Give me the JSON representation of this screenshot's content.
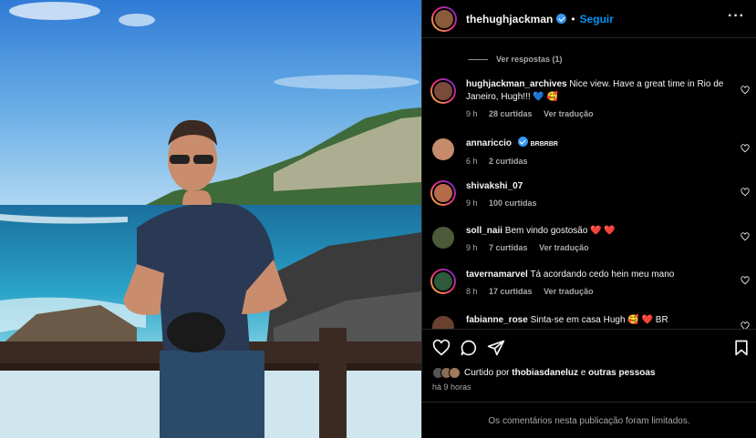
{
  "header": {
    "username": "thehughjackman",
    "separator": "•",
    "follow_label": "Seguir",
    "more_icon": "more-options-icon"
  },
  "replies": {
    "label": "Ver respostas (1)"
  },
  "comments": [
    {
      "user": "hughjackman_archives",
      "text": "Nice view. Have a great time in Rio de Janeiro, Hugh!!! 💙 🥰",
      "time": "9 h",
      "likes": "28 curtidas",
      "translate": "Ver tradução",
      "verified": false,
      "avatar_color": "#7a4a3a"
    },
    {
      "user": "annariccio",
      "text": "BRBRBR",
      "time": "6 h",
      "likes": "2 curtidas",
      "translate": "",
      "verified": true,
      "avatar_color": "#c58b6a"
    },
    {
      "user": "shivakshi_07",
      "text": "",
      "time": "9 h",
      "likes": "100 curtidas",
      "translate": "",
      "verified": false,
      "avatar_color": "#b56a4a"
    },
    {
      "user": "soll_naii",
      "text": "Bem vindo gostosão ❤️ ❤️",
      "time": "9 h",
      "likes": "7 curtidas",
      "translate": "Ver tradução",
      "verified": false,
      "avatar_color": "#4d5a3a"
    },
    {
      "user": "tavernamarvel",
      "text": "Tá acordando cedo hein meu mano",
      "time": "8 h",
      "likes": "17 curtidas",
      "translate": "Ver tradução",
      "verified": false,
      "avatar_color": "#2f5a3a"
    },
    {
      "user": "fabianne_rose",
      "text": "Sinta-se em casa Hugh 🥰 ❤️ BR",
      "time": "",
      "likes": "",
      "translate": "",
      "verified": false,
      "avatar_color": "#6a4030"
    }
  ],
  "actions": {
    "like_icon": "heart-icon",
    "comment_icon": "comment-icon",
    "share_icon": "send-icon",
    "save_icon": "bookmark-icon"
  },
  "likes": {
    "prefix": "Curtido por",
    "user": "thobiasdaneluz",
    "conjunction": "e",
    "others": "outras pessoas"
  },
  "time_ago": "há 9 horas",
  "limited_notice": "Os comentários nesta publicação foram limitados.",
  "colors": {
    "accent": "#0095f6",
    "verified": "#3897f0",
    "background": "#000000",
    "muted": "#a8a8a8"
  }
}
